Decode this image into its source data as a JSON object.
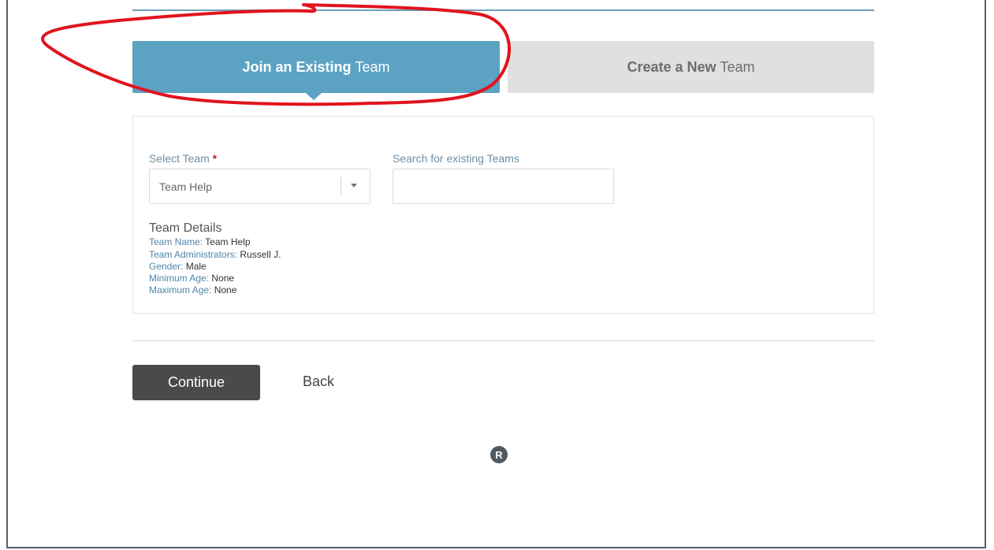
{
  "tabs": {
    "join": {
      "bold": "Join an Existing",
      "rest": "Team"
    },
    "create": {
      "bold": "Create a New",
      "rest": "Team"
    }
  },
  "form": {
    "select_team_label": "Select Team",
    "required_marker": "*",
    "select_team_value": "Team Help",
    "search_label": "Search for existing Teams",
    "search_value": ""
  },
  "details": {
    "title": "Team Details",
    "rows": [
      {
        "key": "Team Name:",
        "value": "Team Help"
      },
      {
        "key": "Team Administrators:",
        "value": "Russell J."
      },
      {
        "key": "Gender:",
        "value": "Male"
      },
      {
        "key": "Minimum Age:",
        "value": "None"
      },
      {
        "key": "Maximum Age:",
        "value": "None"
      }
    ]
  },
  "actions": {
    "continue_label": "Continue",
    "back_label": "Back"
  },
  "footer": {
    "logo_letter": "R"
  },
  "colors": {
    "accent": "#5ba2c3",
    "inactive_tab": "#e0e0e0",
    "annotation": "#e0141e"
  }
}
